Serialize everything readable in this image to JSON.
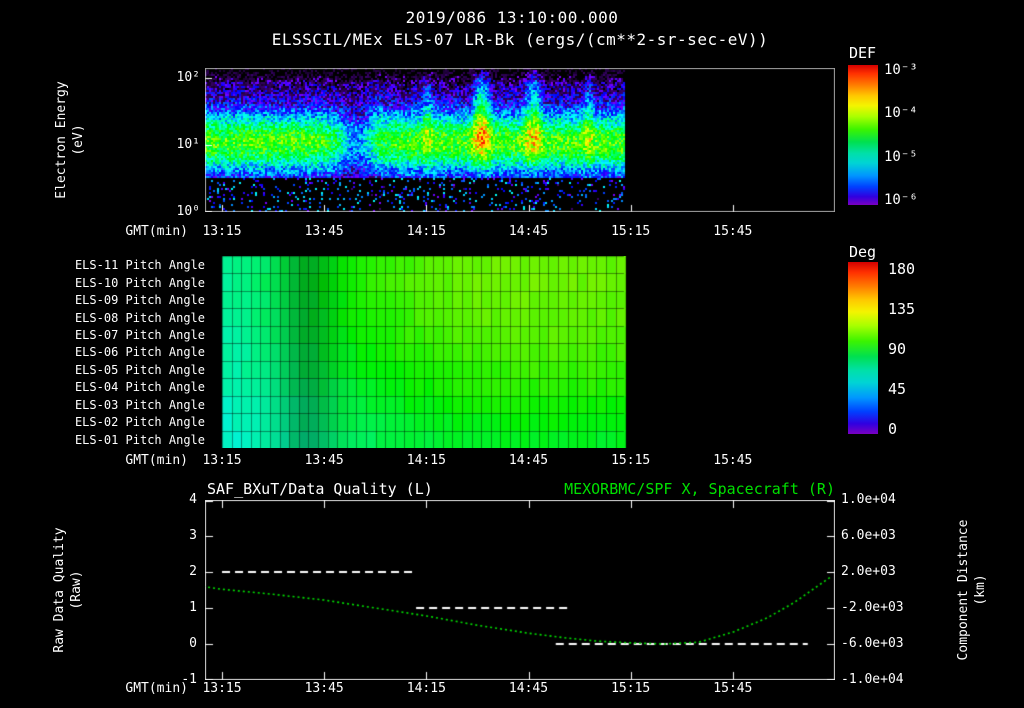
{
  "title": "2019/086 13:10:00.000",
  "colors": {
    "background": "#000000",
    "foreground": "#ffffff",
    "accent_green": "#00e000"
  },
  "time_axis": {
    "label": "GMT(min)",
    "start_minute": 790,
    "end_minute": 975,
    "ticks": [
      {
        "minute": 795,
        "label": "13:15"
      },
      {
        "minute": 825,
        "label": "13:45"
      },
      {
        "minute": 855,
        "label": "14:15"
      },
      {
        "minute": 885,
        "label": "14:45"
      },
      {
        "minute": 915,
        "label": "15:15"
      },
      {
        "minute": 945,
        "label": "15:45"
      }
    ]
  },
  "panel_energy": {
    "subtitle": "ELSSCIL/MEx ELS-07 LR-Bk  (ergs/(cm**2-sr-sec-eV))",
    "ylabel_line1": "Electron Energy",
    "ylabel_line2": "(eV)",
    "yticks": [
      "10²",
      "10¹",
      "10⁰"
    ],
    "colorbar_title": "DEF",
    "colorbar_ticks": [
      "10⁻³",
      "10⁻⁴",
      "10⁻⁵",
      "10⁻⁶"
    ]
  },
  "panel_pitch": {
    "row_labels": [
      "ELS-11 Pitch Angle",
      "ELS-10 Pitch Angle",
      "ELS-09 Pitch Angle",
      "ELS-08 Pitch Angle",
      "ELS-07 Pitch Angle",
      "ELS-06 Pitch Angle",
      "ELS-05 Pitch Angle",
      "ELS-04 Pitch Angle",
      "ELS-03 Pitch Angle",
      "ELS-02 Pitch Angle",
      "ELS-01 Pitch Angle"
    ],
    "colorbar_title": "Deg",
    "colorbar_ticks": [
      "180",
      "135",
      "90",
      "45",
      "0"
    ]
  },
  "panel_line": {
    "left_title": "SAF_BXuT/Data Quality (L)",
    "right_title": "MEXORBMC/SPF X, Spacecraft (R)",
    "left_ylabel_line1": "Raw Data Quality",
    "left_ylabel_line2": "(Raw)",
    "right_ylabel_line1": "Component Distance",
    "right_ylabel_line2": "(km)",
    "left_yticks": [
      "4",
      "3",
      "2",
      "1",
      "0",
      "-1"
    ],
    "right_yticks": [
      "1.0e+04",
      "6.0e+03",
      "2.0e+03",
      "-2.0e+03",
      "-6.0e+03",
      "-1.0e+04"
    ]
  },
  "chart_data": [
    {
      "type": "heatmap",
      "title": "ELSSCIL/MEx ELS-07 LR-Bk",
      "units": "ergs/(cm**2-sr-sec-eV)",
      "xlabel": "GMT(min)",
      "ylabel": "Electron Energy (eV)",
      "x_tick_labels": [
        "13:15",
        "13:45",
        "14:15",
        "14:45",
        "15:15",
        "15:45"
      ],
      "data_start_minute": 790,
      "data_end_minute": 913,
      "y_range_ev": [
        1,
        140
      ],
      "y_scale": "log",
      "color_range_flux": [
        1e-06,
        0.001
      ],
      "band_center_log10ev": 1.05,
      "band_sigma_log10ev": 0.33,
      "description": "Broadband electron spectrogram: intense cyan-green band ~5-40 eV near 1e-4.5, weak blue flux above, sparse violet noise below 4 eV, vertical yellow-green flux enhancements after ~14:00; data ends ~15:13."
    },
    {
      "type": "heatmap",
      "title": "ELS Pitch Angles",
      "rows": [
        "ELS-11",
        "ELS-10",
        "ELS-09",
        "ELS-08",
        "ELS-07",
        "ELS-06",
        "ELS-05",
        "ELS-04",
        "ELS-03",
        "ELS-02",
        "ELS-01"
      ],
      "color_range_deg": [
        0,
        180
      ],
      "data_start_minute": 795,
      "data_end_minute": 913,
      "time_bins_frac": [
        0,
        0.08,
        0.18,
        0.3,
        0.45,
        0.6,
        0.8,
        1.0
      ],
      "degrees": [
        [
          68,
          75,
          84,
          96,
          106,
          112,
          113,
          111
        ],
        [
          68,
          75,
          85,
          97,
          107,
          112,
          113,
          111
        ],
        [
          67,
          74,
          83,
          95,
          106,
          111,
          112,
          110
        ],
        [
          66,
          73,
          82,
          94,
          104,
          110,
          111,
          109
        ],
        [
          65,
          72,
          81,
          92,
          102,
          108,
          109,
          107
        ],
        [
          64,
          70,
          79,
          90,
          100,
          105,
          107,
          105
        ],
        [
          63,
          69,
          77,
          88,
          97,
          102,
          104,
          102
        ],
        [
          62,
          67,
          75,
          85,
          94,
          99,
          101,
          99
        ],
        [
          60,
          65,
          72,
          82,
          90,
          95,
          97,
          95
        ],
        [
          58,
          63,
          70,
          79,
          86,
          91,
          93,
          91
        ],
        [
          57,
          62,
          68,
          76,
          83,
          88,
          89,
          87
        ]
      ]
    },
    {
      "type": "line",
      "xlabel": "GMT(min)",
      "left_ylim": [
        -1,
        4
      ],
      "right_ylim": [
        -10000,
        10000
      ],
      "series": [
        {
          "name": "SAF_BXuT/Data Quality (L)",
          "axis": "left",
          "style": "dashed-white",
          "segments": [
            {
              "start_minute": 795,
              "end_minute": 852,
              "quality": 2
            },
            {
              "start_minute": 852,
              "end_minute": 897,
              "quality": 1
            },
            {
              "start_minute": 893,
              "end_minute": 967,
              "quality": 0
            }
          ]
        },
        {
          "name": "MEXORBMC/SPF X, Spacecraft (R)",
          "axis": "right",
          "style": "dotted-green",
          "points_minute_km": [
            [
              788,
              480
            ],
            [
              795,
              80
            ],
            [
              810,
              -480
            ],
            [
              825,
              -1120
            ],
            [
              840,
              -2000
            ],
            [
              855,
              -2880
            ],
            [
              870,
              -3920
            ],
            [
              885,
              -4800
            ],
            [
              895,
              -5280
            ],
            [
              905,
              -5680
            ],
            [
              915,
              -5880
            ],
            [
              925,
              -6000
            ],
            [
              935,
              -5800
            ],
            [
              945,
              -4680
            ],
            [
              955,
              -3120
            ],
            [
              963,
              -1400
            ],
            [
              969,
              200
            ],
            [
              974,
              1520
            ]
          ]
        }
      ]
    }
  ]
}
